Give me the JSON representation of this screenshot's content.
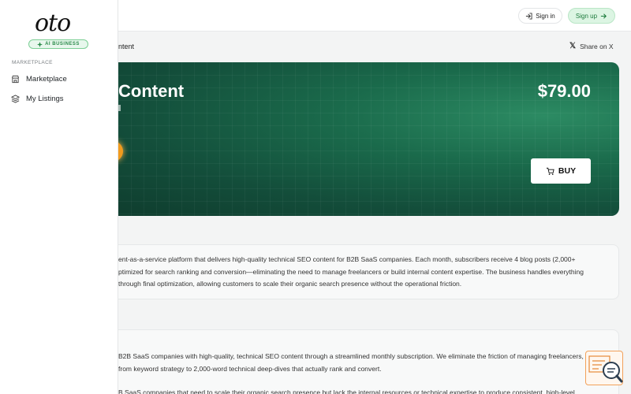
{
  "header": {
    "signin_label": "Sign in",
    "signup_label": "Sign up"
  },
  "breadcrumb": {
    "text": "ntent"
  },
  "share": {
    "label": "Share on X"
  },
  "hero": {
    "title": "Content",
    "price": "$79.00",
    "buy_label": "BUY"
  },
  "description": {
    "lines": [
      "ent-as-a-service platform that delivers high-quality technical SEO content for B2B SaaS companies. Each month, subscribers receive 4 blog posts (2,000+",
      "ptimized for search ranking and conversion—eliminating the need to manage freelancers or build internal content expertise. The business handles everything",
      "through final optimization, allowing customers to scale their organic search presence without the operational friction."
    ]
  },
  "details": {
    "lines": [
      "B2B SaaS companies with high-quality, technical SEO content through a streamlined monthly subscription. We eliminate the friction of managing freelancers,",
      "from keyword strategy to 2,000-word technical deep-dives that actually rank and convert.",
      "B SaaS companies that need to scale their organic search presence but lack the internal resources or technical expertise to produce consistent, high-level"
    ]
  },
  "sidebar": {
    "logo": "oto",
    "badge": "AI BUSINESS",
    "section": "MARKETPLACE",
    "items": [
      {
        "label": "Marketplace",
        "icon": "store-icon"
      },
      {
        "label": "My Listings",
        "icon": "layers-icon"
      }
    ]
  },
  "colors": {
    "accent_green": "#1b7a3b",
    "hero_bg": "#134d3a",
    "orb": "#f29b1d"
  }
}
